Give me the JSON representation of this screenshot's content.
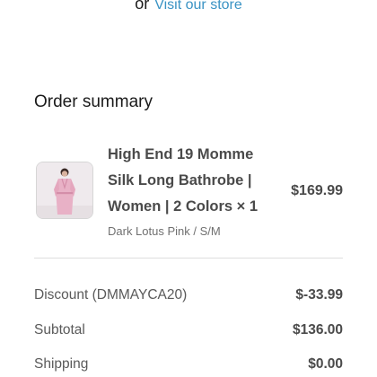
{
  "store": {
    "or_text": "or",
    "link_label": "Visit our store"
  },
  "summary": {
    "title": "Order summary"
  },
  "product": {
    "title_line": "High End 19 Momme Silk Long Bathrobe | Women | 2 Colors × 1",
    "variant": "Dark Lotus Pink / S/M",
    "price": "$169.99",
    "thumbnail_icon": "pink-bathrobe-photo"
  },
  "totals": {
    "discount_label": "Discount (DMMAYCA20)",
    "discount_value": "$-33.99",
    "subtotal_label": "Subtotal",
    "subtotal_value": "$136.00",
    "shipping_label": "Shipping",
    "shipping_value": "$0.00"
  },
  "colors": {
    "link": "#3a93c4",
    "text": "#1a1a1a",
    "muted": "#707070"
  }
}
